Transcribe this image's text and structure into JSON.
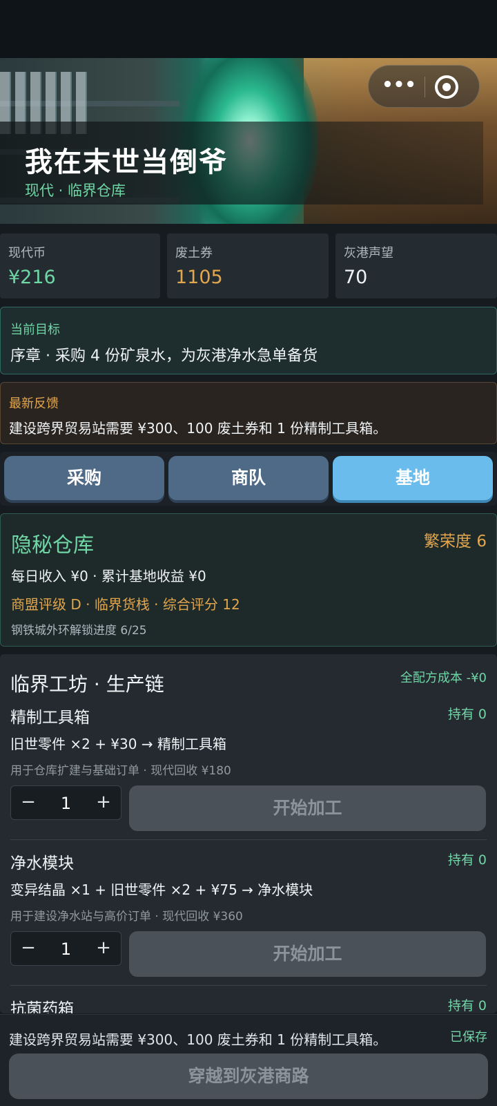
{
  "hero": {
    "title": "我在末世当倒爷",
    "subtitle": "现代 · 临界仓库",
    "more_glyph": "•••",
    "target_glyph": "◉"
  },
  "stats": [
    {
      "label": "现代币",
      "value": "¥216",
      "color": "#6fd6a6"
    },
    {
      "label": "废土券",
      "value": "1105",
      "color": "#e2a64e"
    },
    {
      "label": "灰港声望",
      "value": "70",
      "color": "#f0f3f5"
    }
  ],
  "goal": {
    "label": "当前目标",
    "text": "序章 · 采购 4 份矿泉水，为灰港净水急单备货"
  },
  "feedback": {
    "label": "最新反馈",
    "text": "建设跨界贸易站需要 ¥300、100 废土券和 1 份精制工具箱。"
  },
  "tabs": [
    {
      "label": "采购",
      "active": false
    },
    {
      "label": "商队",
      "active": false
    },
    {
      "label": "基地",
      "active": true
    }
  ],
  "base": {
    "name": "隐秘仓库",
    "prosperity": "繁荣度 6",
    "income_line": "每日收入 ¥0 · 累计基地收益 ¥0",
    "rating_line": "商盟评级 D · 临界货栈 · 综合评分 12",
    "unlock_line": "钢铁城外环解锁进度 6/25"
  },
  "workshop": {
    "title": "临界工坊 · 生产链",
    "cost": "全配方成本 -¥0",
    "recipes": [
      {
        "name": "精制工具箱",
        "hold": "持有 0",
        "formula": "旧世零件 ×2 + ¥30 → 精制工具箱",
        "desc": "用于仓库扩建与基础订单 · 现代回收 ¥180",
        "qty": "1",
        "minus": "−",
        "plus": "+",
        "button": "开始加工"
      },
      {
        "name": "净水模块",
        "hold": "持有 0",
        "formula": "变异结晶 ×1 + 旧世零件 ×2 + ¥75 → 净水模块",
        "desc": "用于建设净水站与高价订单 · 现代回收 ¥360",
        "qty": "1",
        "minus": "−",
        "plus": "+",
        "button": "开始加工"
      },
      {
        "name": "抗菌药箱",
        "hold": "持有 0"
      }
    ]
  },
  "footer": {
    "message": "建设跨界贸易站需要 ¥300、100 废土券和 1 份精制工具箱。",
    "saved": "已保存",
    "action": "穿越到灰港商路"
  }
}
